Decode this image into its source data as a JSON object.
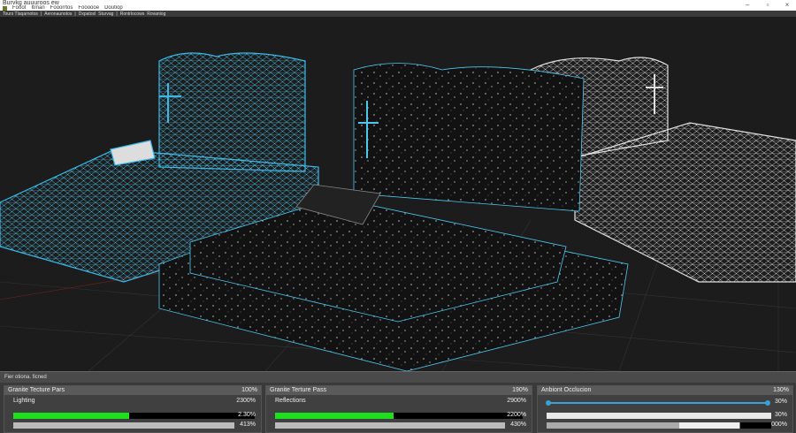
{
  "window": {
    "title": "Burvkg auuuroos ew",
    "controls": [
      "minimize",
      "maximize",
      "close"
    ]
  },
  "menu": [
    "Fooot",
    "Itrnan",
    "Fooorrtos",
    "Foooooe",
    "Doutiop"
  ],
  "toolbar": [
    "Tours Tlaqarnotos",
    "Aeronaunotos",
    "Dxpatosl",
    "Sturvag",
    "Rontrlocows",
    "Rovaniog"
  ],
  "status": "Fier otiona. ficned",
  "panels": [
    {
      "title": "Granite Tecture Pars",
      "value": "100%",
      "label": "Lighting",
      "label_value": "2300%",
      "bar1_fraction": 0.48,
      "bar1_value": "2.30%",
      "bar2_value": "413%",
      "accent": "#1fe01f"
    },
    {
      "title": "Granite Terture Pass",
      "value": "190%",
      "label": "Reflections",
      "label_value": "2900%",
      "bar1_fraction": 0.48,
      "bar1_value": "2200%",
      "bar2_value": "430%",
      "accent": "#1fe01f"
    },
    {
      "title": "Anbiont Occlucion",
      "value": "130%",
      "slider_value": "30%",
      "slider_fraction": 1.0,
      "bar1_value": "30%",
      "bar2_value": "000%",
      "accent": "#3aa0d8"
    }
  ]
}
